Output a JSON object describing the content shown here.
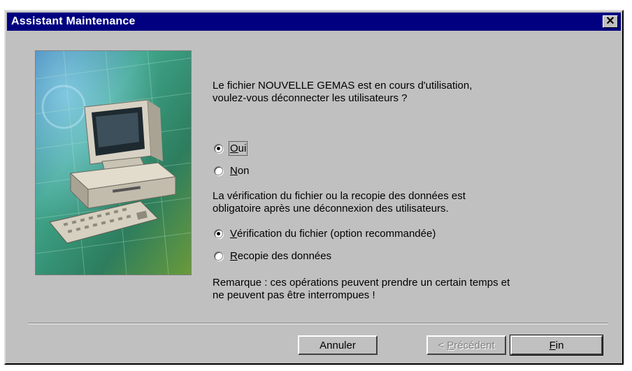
{
  "window": {
    "title": "Assistant Maintenance",
    "close_label": "✕"
  },
  "message": {
    "line1": "Le fichier NOUVELLE GEMAS  est en cours d'utilisation,",
    "line2": "voulez-vous déconnecter les utilisateurs ?"
  },
  "disconnect_options": [
    {
      "label_mnemonic": "O",
      "label_rest": "ui",
      "selected": true
    },
    {
      "label_mnemonic": "N",
      "label_rest": "on",
      "selected": false
    }
  ],
  "info": {
    "line1": "La vérification du fichier ou la recopie des données est",
    "line2": "obligatoire après une déconnexion des utilisateurs."
  },
  "action_options": [
    {
      "label_mnemonic": "V",
      "label_rest": "érification du fichier (option recommandée)",
      "selected": true
    },
    {
      "label_mnemonic": "R",
      "label_rest": "ecopie des données",
      "selected": false
    }
  ],
  "remark": {
    "line1": "Remarque : ces opérations peuvent prendre un certain temps et",
    "line2": "ne peuvent pas être interrompues !"
  },
  "buttons": {
    "cancel": "Annuler",
    "previous_prefix": "< ",
    "previous_mnemonic": "P",
    "previous_rest": "récédent",
    "finish_mnemonic": "F",
    "finish_rest": "in"
  },
  "colors": {
    "titlebar": "#000080",
    "face": "#c0c0c0"
  }
}
